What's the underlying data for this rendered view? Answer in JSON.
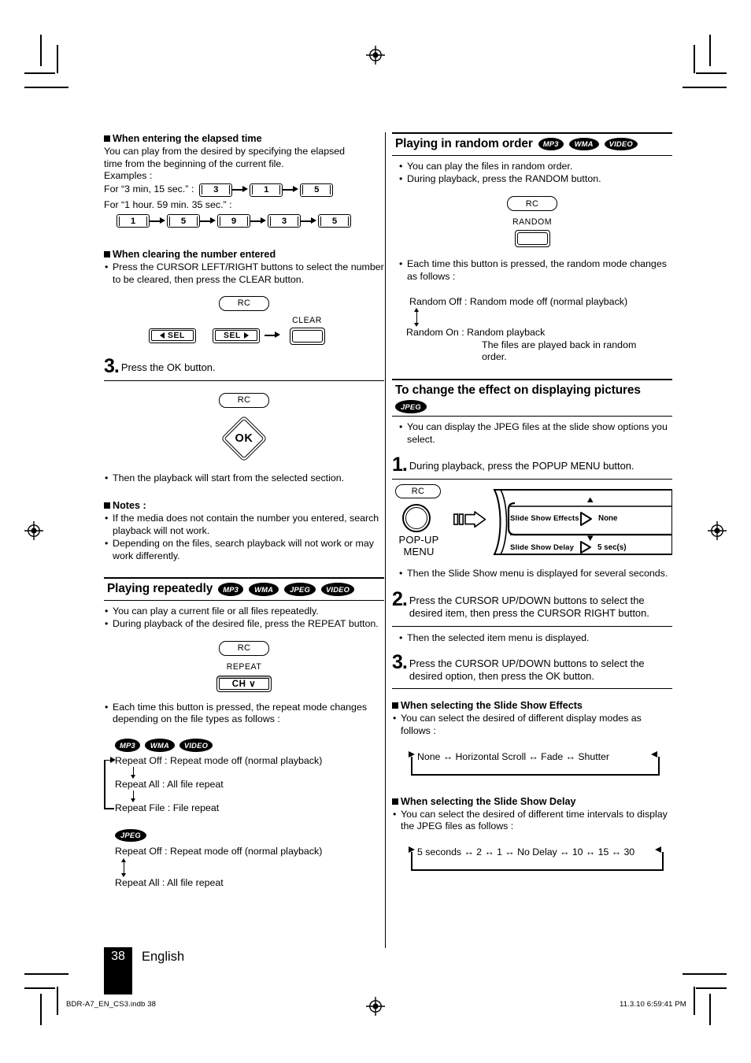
{
  "page": {
    "number": "38",
    "language": "English",
    "footer_left": "BDR-A7_EN_CS3.indb   38",
    "footer_right": "11.3.10   6:59:41 PM"
  },
  "left_column": {
    "elapsed": {
      "heading": "When entering the elapsed time",
      "body_line1": "You can play from the desired by specifying the elapsed",
      "body_line2": "time from the beginning of the current file.",
      "examples_label": "Examples :",
      "example1_label": "For “3 min, 15 sec.” :",
      "example1_keys": [
        "3",
        "1",
        "5"
      ],
      "example2_label": "For “1 hour. 59 min. 35 sec.” :",
      "example2_keys": [
        "1",
        "5",
        "9",
        "3",
        "5"
      ]
    },
    "clearing": {
      "heading": "When clearing the number entered",
      "bullet": "Press the CURSOR LEFT/RIGHT buttons to select the number to be cleared, then press the CLEAR button.",
      "rc_label": "RC",
      "sel_left_label": "SEL",
      "sel_right_label": "SEL",
      "clear_label": "CLEAR"
    },
    "step3": {
      "number": "3",
      "text": "Press the OK button.",
      "rc_label": "RC",
      "ok_label": "OK",
      "result_bullet": "Then the playback will start from the selected section."
    },
    "notes": {
      "heading": "Notes :",
      "items": [
        "If the media does not contain the number you entered, search playback will not work.",
        "Depending on the files, search playback will not work or may work differently."
      ]
    },
    "repeat_section": {
      "title": "Playing repeatedly",
      "badges": [
        "MP3",
        "WMA",
        "JPEG",
        "VIDEO"
      ],
      "bullets": [
        "You can play a current file or all files repeatedly.",
        "During playback of the desired file, press the REPEAT button."
      ],
      "rc_label": "RC",
      "repeat_label": "REPEAT",
      "ch_button_label": "CH ∨",
      "each_time_bullet": "Each time this button is pressed, the repeat mode changes depending on the file types as follows :",
      "flow_av": {
        "badges": [
          "MP3",
          "WMA",
          "VIDEO"
        ],
        "items": [
          "Repeat Off : Repeat mode off (normal playback)",
          "Repeat All : All file repeat",
          "Repeat File : File repeat"
        ]
      },
      "flow_jpeg": {
        "badges": [
          "JPEG"
        ],
        "items": [
          "Repeat Off : Repeat mode off (normal playback)",
          "Repeat All : All file repeat"
        ]
      }
    }
  },
  "right_column": {
    "random_section": {
      "title": "Playing in random order",
      "badges": [
        "MP3",
        "WMA",
        "VIDEO"
      ],
      "bullets": [
        "You can play the files in random order.",
        "During playback, press the RANDOM button."
      ],
      "rc_label": "RC",
      "random_label": "RANDOM",
      "each_time_bullet": "Each time this button is pressed, the random mode changes as follows :",
      "flow": {
        "item1": "Random Off : Random mode off (normal playback)",
        "item2": "Random On : Random playback",
        "item2_sub1": "The files are played back in random",
        "item2_sub2": "order."
      }
    },
    "effect_section": {
      "title": "To change the effect on displaying pictures",
      "badges": [
        "JPEG"
      ],
      "bullets": [
        "You can display the JPEG files at the slide show options you select."
      ],
      "step1": {
        "number": "1",
        "text": "During playback, press the POPUP MENU button."
      },
      "diagram": {
        "rc_label": "RC",
        "popup_label_line1": "POP-UP",
        "popup_label_line2": "MENU",
        "menu_rows": [
          {
            "label": "Slide Show Effects",
            "value": "None"
          },
          {
            "label": "Slide Show Delay",
            "value": "5 sec(s)"
          }
        ]
      },
      "step1_result": "Then the Slide Show menu is displayed for several seconds.",
      "step2": {
        "number": "2",
        "text": "Press the CURSOR UP/DOWN buttons to select the desired item, then press the CURSOR RIGHT button."
      },
      "step2_result": "Then the selected item menu is displayed.",
      "step3": {
        "number": "3",
        "text": "Press the CURSOR UP/DOWN buttons to select the desired option, then press the OK button."
      },
      "effects": {
        "heading": "When selecting the Slide Show Effects",
        "bullet": "You can select the desired of different display modes as follows :",
        "cycle": "None  ↔  Horizontal Scroll  ↔ Fade  ↔ Shutter"
      },
      "delay": {
        "heading": "When selecting the Slide Show Delay",
        "bullet": "You can select the desired of different time intervals to display the JPEG files as follows :",
        "cycle": "5 seconds ↔ 2 ↔ 1 ↔ No Delay ↔ 10 ↔ 15 ↔ 30"
      }
    }
  }
}
